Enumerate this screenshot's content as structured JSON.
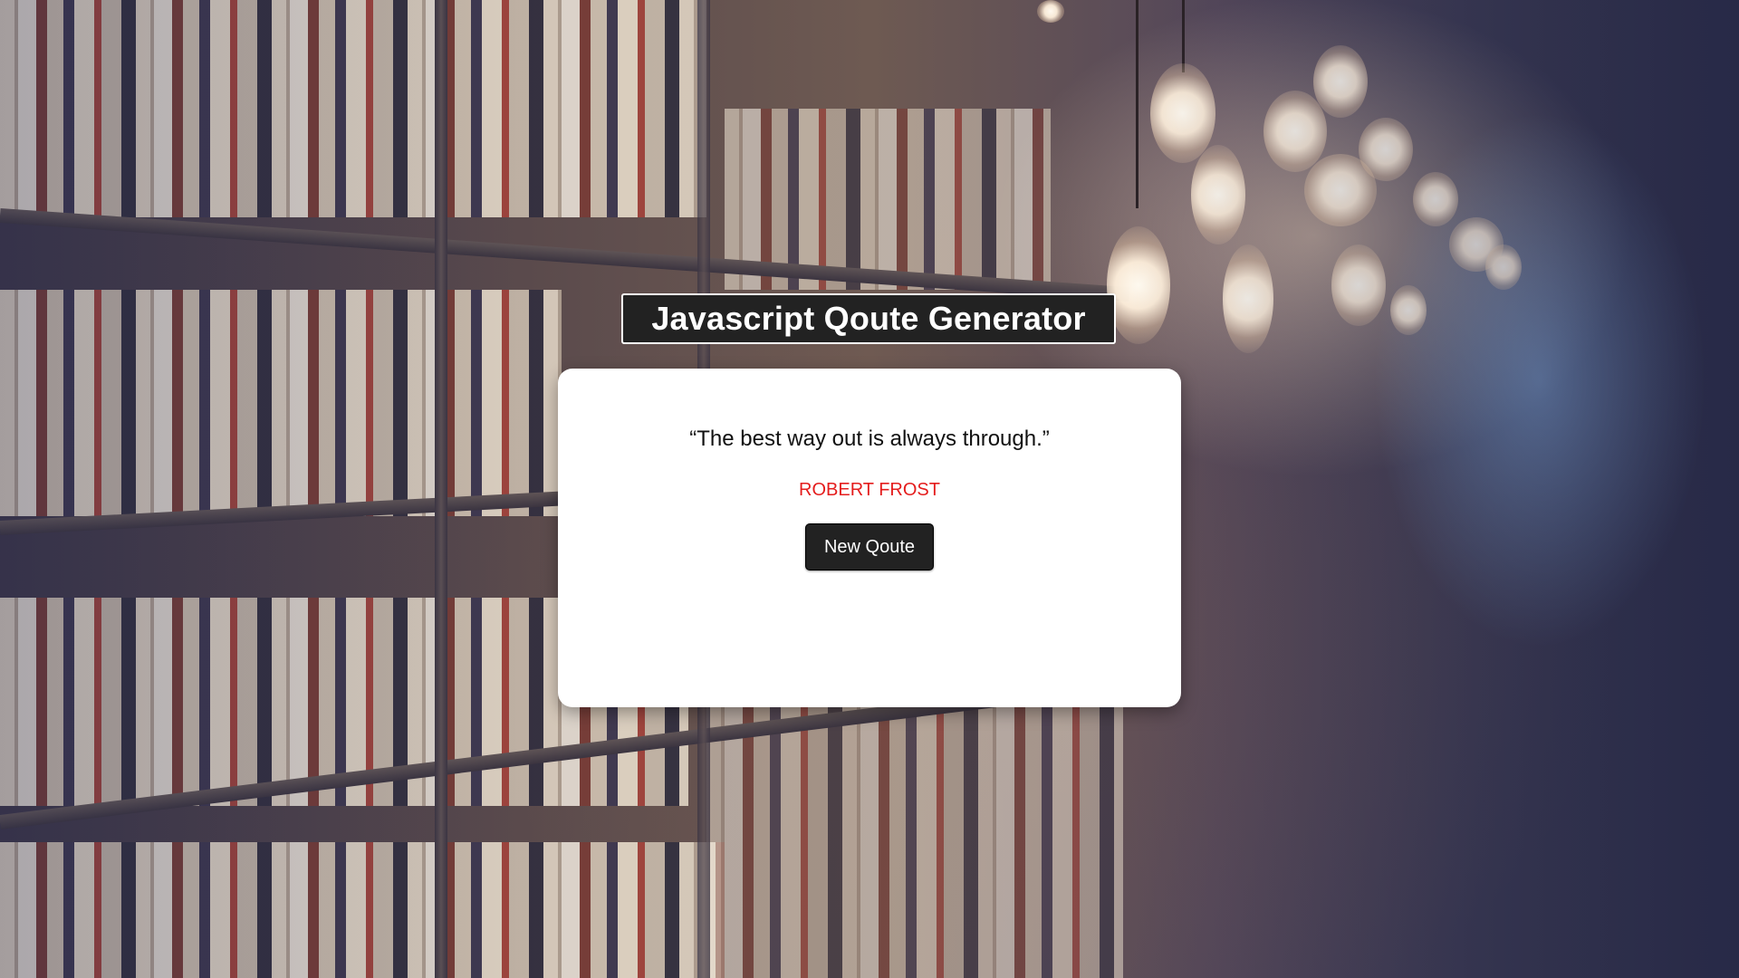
{
  "app": {
    "title": "Javascript Qoute Generator"
  },
  "quote": {
    "text": "“The best way out is always through.”",
    "author": "ROBERT FROST"
  },
  "actions": {
    "new_quote_label": "New Qoute"
  },
  "colors": {
    "title_bg": "#222222",
    "card_bg": "#ffffff",
    "author_text": "#e41c1c",
    "button_bg": "#222222"
  },
  "background": {
    "icon": "library-bookshelves-photo"
  }
}
